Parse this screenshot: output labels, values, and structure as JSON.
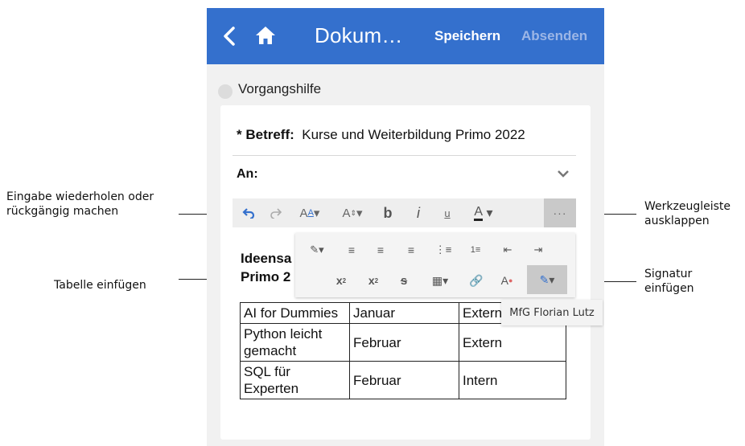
{
  "header": {
    "title": "Dokum…",
    "save_label": "Speichern",
    "send_label": "Absenden"
  },
  "vorgangshilfe": {
    "label": "Vorgangshilfe"
  },
  "form": {
    "subject_label": "* Betreff:",
    "subject_value": "Kurse und Weiterbildung Primo 2022",
    "to_label": "An:"
  },
  "editor": {
    "heading_line1": "Ideensa",
    "heading_line2": "Primo 2",
    "table": {
      "rows": [
        [
          "AI for Dummies",
          "Januar",
          "Extern"
        ],
        [
          "Python leicht gemacht",
          "Februar",
          "Extern"
        ],
        [
          "SQL für Experten",
          "Februar",
          "Intern"
        ]
      ]
    },
    "signature_tooltip": "MfG Florian Lutz"
  },
  "annotations": {
    "undo_redo": "Eingabe wiederholen oder rückgängig machen",
    "table_insert": "Tabelle einfügen",
    "expand_toolbar": "Werkzeugleiste ausklappen",
    "signature_insert": "Signatur einfügen"
  },
  "colors": {
    "accent": "#3470cd",
    "send_disabled": "#9cb6e6"
  }
}
